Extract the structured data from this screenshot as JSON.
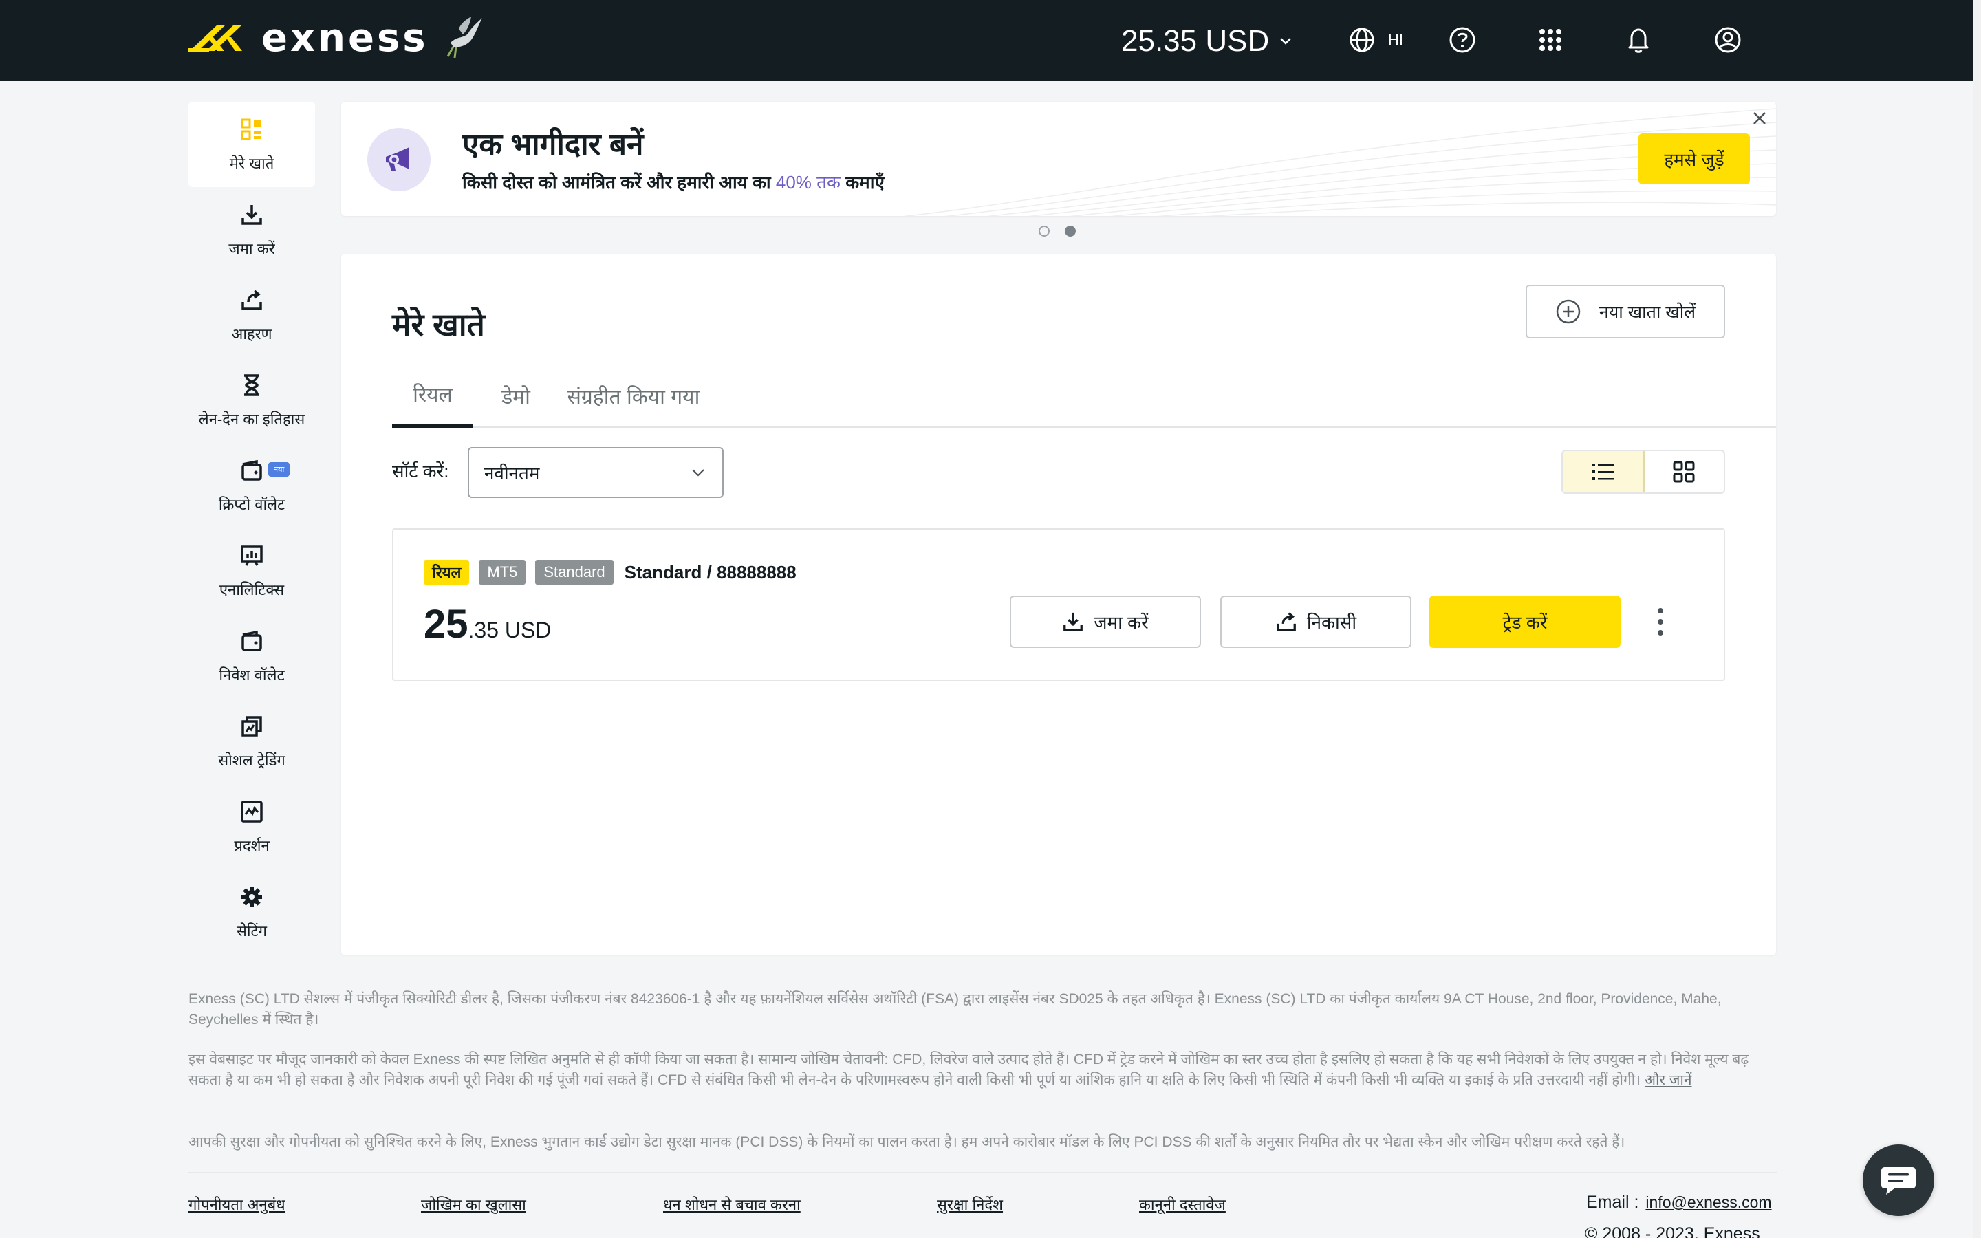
{
  "header": {
    "logo_text": "exness",
    "balance": "25.35 USD",
    "language": "HI"
  },
  "sidebar": {
    "items": [
      {
        "label": "मेरे खाते",
        "icon": "accounts-icon"
      },
      {
        "label": "जमा करें",
        "icon": "deposit-icon"
      },
      {
        "label": "आहरण",
        "icon": "withdraw-icon"
      },
      {
        "label": "लेन-देन का इतिहास",
        "icon": "hourglass-icon"
      },
      {
        "label": "क्रिप्टो वॉलेट",
        "icon": "wallet-icon",
        "badge": "नया"
      },
      {
        "label": "एनालिटिक्स",
        "icon": "analytics-icon"
      },
      {
        "label": "निवेश वॉलेट",
        "icon": "wallet-icon"
      },
      {
        "label": "सोशल ट्रेडिंग",
        "icon": "social-trading-icon"
      },
      {
        "label": "प्रदर्शन",
        "icon": "performance-icon"
      },
      {
        "label": "सेटिंग",
        "icon": "gear-icon"
      }
    ]
  },
  "banner": {
    "title": "एक भागीदार बनें",
    "subtitle_pre": "किसी दोस्त को आमंत्रित करें और हमारी आय का",
    "subtitle_accent": "40% तक",
    "subtitle_post": "कमाएँ",
    "button": "हमसे जुड़ें"
  },
  "accounts": {
    "title": "मेरे खाते",
    "new_account_button": "नया खाता खोलें",
    "tabs": [
      "रियल",
      "डेमो",
      "संग्रहीत किया गया"
    ],
    "sort_label": "सॉर्ट करें:",
    "sort_value": "नवीनतम",
    "card": {
      "tag_real": "रियल",
      "tag_platform": "MT5",
      "tag_type": "Standard",
      "name": "Standard / 88888888",
      "balance_int": "25",
      "balance_dec": ".35 USD",
      "deposit_button": "जमा करें",
      "withdraw_button": "निकासी",
      "trade_button": "ट्रेड करें"
    }
  },
  "footer": {
    "legal_1": "Exness (SC) LTD सेशल्स में पंजीकृत सिक्योरिटी डीलर है, जिसका पंजीकरण नंबर 8423606-1 है और यह फ़ायनेंशियल सर्विसेस अथॉरिटी (FSA) द्वारा लाइसेंस नंबर SD025 के तहत अधिकृत है। Exness (SC) LTD का पंजीकृत कार्यालय 9A CT House, 2nd floor, Providence, Mahe, Seychelles में स्थित है।",
    "legal_2": "इस वेबसाइट पर मौजूद जानकारी को केवल Exness की स्पष्ट लिखित अनुमति से ही कॉपी किया जा सकता है। सामान्य जोखिम चेतावनी: CFD, लिवरेज वाले उत्पाद होते हैं। CFD में ट्रेड करने में जोखिम का स्तर उच्च होता है इसलिए हो सकता है कि यह सभी निवेशकों के लिए उपयुक्त न हो। निवेश मूल्य बढ़ सकता है या कम भी हो सकता है और निवेशक अपनी पूरी निवेश की गई पूंजी गवां सकते हैं। CFD से संबंधित किसी भी लेन-देन के परिणामस्वरूप होने वाली किसी भी पूर्ण या आंशिक हानि या क्षति के लिए किसी भी स्थिति में कंपनी किसी भी व्यक्ति या इकाई के प्रति उत्तरदायी नहीं होगी।",
    "legal_2_link": "और जानें",
    "legal_3": "आपकी सुरक्षा और गोपनीयता को सुनिश्चित करने के लिए, Exness भुगतान कार्ड उद्योग डेटा सुरक्षा मानक (PCI DSS) के नियमों का पालन करता है। हम अपने कारोबार मॉडल के लिए PCI DSS की शर्तों के अनुसार नियमित तौर पर भेद्यता स्कैन और जोखिम परीक्षण करते रहते हैं।",
    "links": [
      "गोपनीयता अनुबंध",
      "जोखिम का खुलासा",
      "धन शोधन से बचाव करना",
      "सुरक्षा निर्देश",
      "कानूनी दस्तावेज"
    ],
    "email_label": "Email :",
    "email": "info@exness.com",
    "copyright": "© 2008 - 2023. Exness"
  },
  "colors": {
    "header_bg": "#141d22",
    "accent_yellow": "#ffde02",
    "accent_purple": "#6b5fc7"
  }
}
